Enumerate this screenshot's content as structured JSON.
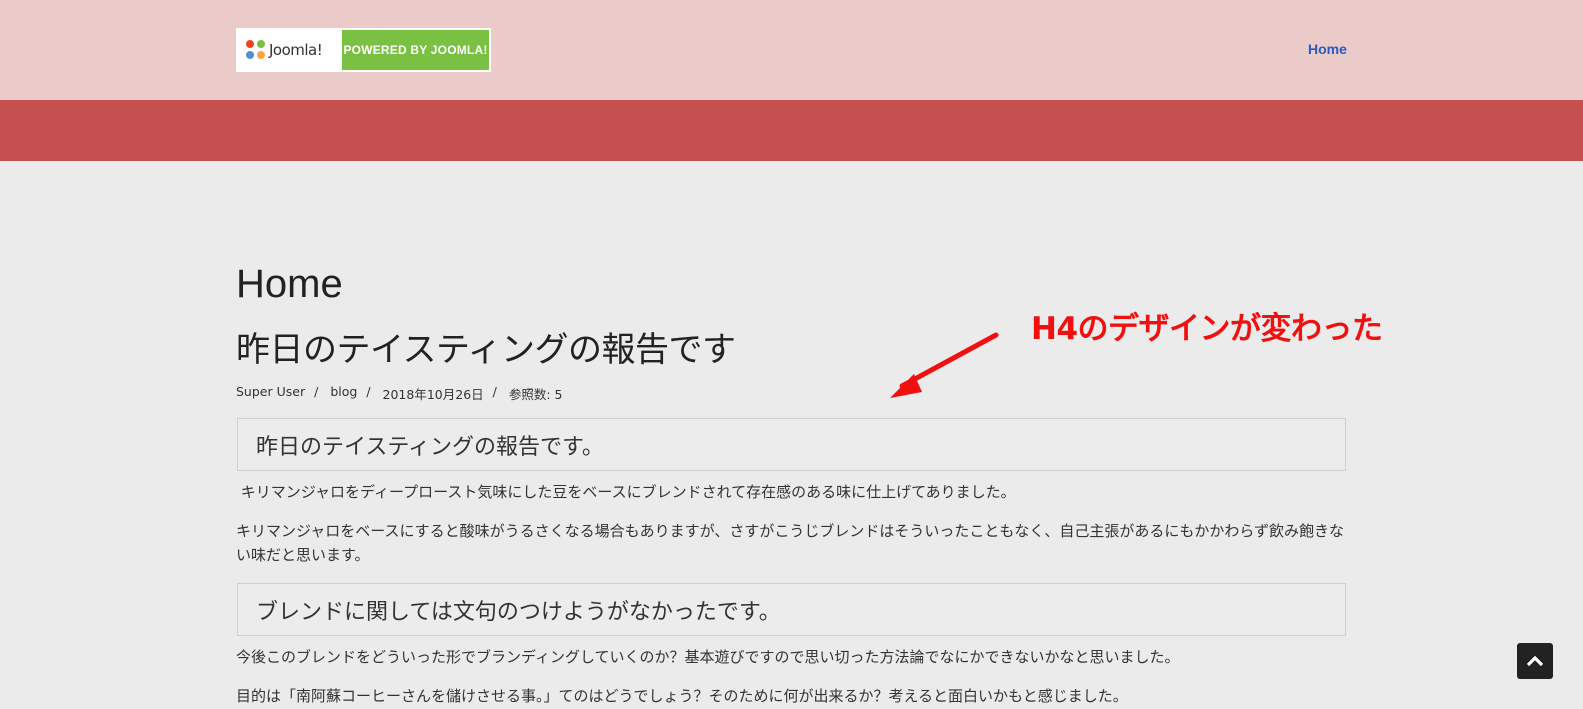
{
  "header": {
    "logo": {
      "brand": "Joomla!",
      "tagline": "POWERED BY JOOMLA!"
    },
    "nav": [
      {
        "label": "Home"
      }
    ]
  },
  "page": {
    "title": "Home"
  },
  "article": {
    "title": "昨日のテイスティングの報告です",
    "meta": {
      "author": "Super User",
      "category": "blog",
      "date": "2018年10月26日",
      "hits": "参照数: 5",
      "separator": "/"
    },
    "blocks": [
      {
        "type": "h4",
        "text": "昨日のテイスティングの報告です。"
      },
      {
        "type": "p",
        "text": " キリマンジャロをディープロースト気味にした豆をベースにブレンドされて存在感のある味に仕上げてありました。"
      },
      {
        "type": "p",
        "text": "キリマンジャロをベースにすると酸味がうるさくなる場合もありますが、さすがこうじブレンドはそういったこともなく、自己主張があるにもかかわらず飲み飽きない味だと思います。"
      },
      {
        "type": "h4",
        "text": "ブレンドに関しては文句のつけようがなかったです。"
      },
      {
        "type": "p",
        "text": "今後このブレンドをどういった形でブランディングしていくのか？基本遊びですので思い切った方法論でなにかできないかなと思いました。"
      },
      {
        "type": "p",
        "text": "目的は「南阿蘇コーヒーさんを儲けさせる事。」てのはどうでしょう？そのために何が出来るか？考えると面白いかもと感じました。"
      }
    ]
  },
  "annotation": {
    "text": "H4のデザインが変わった",
    "color": "#f01010"
  },
  "colors": {
    "header_bg": "#ebcaca",
    "banner_bg": "#c45050",
    "link": "#2a59c3",
    "body_bg": "#ebebeb"
  },
  "icons": {
    "back_to_top": "chevron-up-icon"
  }
}
